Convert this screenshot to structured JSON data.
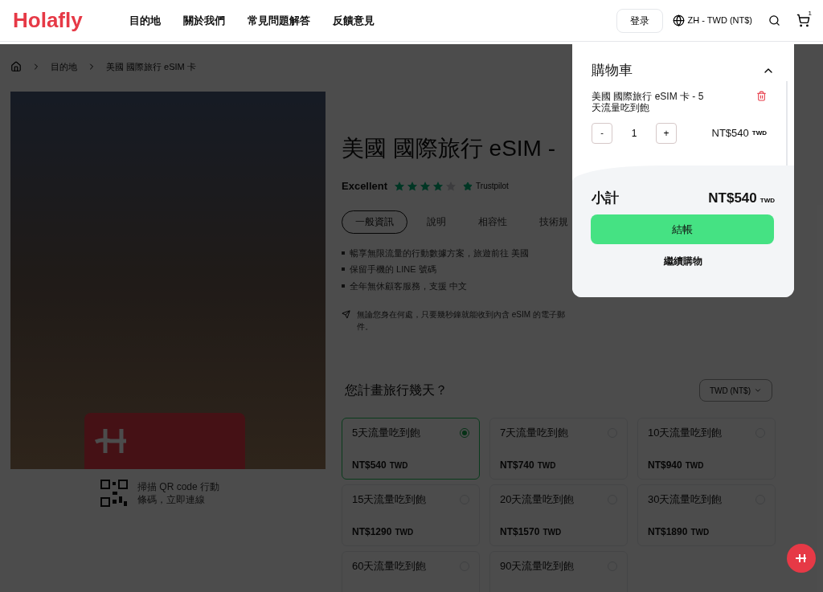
{
  "header": {
    "logo": "Holafly",
    "nav": [
      "目的地",
      "關於我們",
      "常見問題解答",
      "反饋意見"
    ],
    "login": "登录",
    "locale": "ZH - TWD (NT$)",
    "cart_count": "1"
  },
  "breadcrumb": [
    "目的地",
    "美國 國際旅行 eSIM 卡"
  ],
  "product": {
    "title": "美國 國際旅行 eSIM -",
    "rating_label": "Excellent",
    "stars": 4,
    "rating_source": "Trustpilot",
    "tabs": [
      {
        "label": "一般資訊",
        "selected": true
      },
      {
        "label": "說明",
        "selected": false
      },
      {
        "label": "相容性",
        "selected": false
      },
      {
        "label": "技術規",
        "selected": false
      }
    ],
    "features": [
      "暢享無限流量的行動數據方案，旅遊前往 美國",
      "保留手機的 LINE 號碼",
      "全年無休顧客服務，支援 中文"
    ],
    "note": "無論您身在何處，只要幾秒鐘就能收到內含 eSIM 的電子郵件。",
    "qr_caption": "掃描 QR code 行動條碼，立即連線"
  },
  "plans": {
    "question": "您計畫旅行幾天？",
    "currency": "TWD (NT$)",
    "items": [
      {
        "name": "5天流量吃到飽",
        "price": "NT$540",
        "unit": "TWD",
        "selected": true
      },
      {
        "name": "7天流量吃到飽",
        "price": "NT$740",
        "unit": "TWD",
        "selected": false
      },
      {
        "name": "10天流量吃到飽",
        "price": "NT$940",
        "unit": "TWD",
        "selected": false
      },
      {
        "name": "15天流量吃到飽",
        "price": "NT$1290",
        "unit": "TWD",
        "selected": false
      },
      {
        "name": "20天流量吃到飽",
        "price": "NT$1570",
        "unit": "TWD",
        "selected": false
      },
      {
        "name": "30天流量吃到飽",
        "price": "NT$1890",
        "unit": "TWD",
        "selected": false
      },
      {
        "name": "60天流量吃到飽",
        "selected": false
      },
      {
        "name": "90天流量吃到飽",
        "selected": false
      }
    ]
  },
  "cart": {
    "title": "購物車",
    "item": {
      "name": "美國 國際旅行 eSIM 卡 - 5天流量吃到飽",
      "minus": "-",
      "quantity": "1",
      "plus": "+",
      "price": "NT$540",
      "unit": "TWD"
    },
    "subtotal_label": "小計",
    "subtotal": "NT$540",
    "subtotal_unit": "TWD",
    "checkout": "結帳",
    "continue": "繼續購物"
  }
}
